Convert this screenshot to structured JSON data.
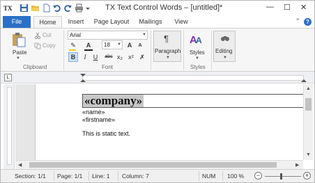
{
  "app": {
    "title": "TX Text Control Words – [untitled]*"
  },
  "window": {
    "minimize": "—",
    "maximize": "☐",
    "close": "✕"
  },
  "quick_access": [
    "app-logo-icon",
    "save-icon",
    "open-folder-icon",
    "new-document-icon",
    "undo-icon",
    "redo-icon",
    "print-icon",
    "qat-dropdown-icon"
  ],
  "tabs": [
    {
      "label": "File"
    },
    {
      "label": "Home"
    },
    {
      "label": "Insert"
    },
    {
      "label": "Page Layout"
    },
    {
      "label": "Mailings"
    },
    {
      "label": "View"
    }
  ],
  "help_label": "?",
  "ribbon": {
    "clipboard": {
      "label": "Clipboard",
      "paste": "Paste",
      "cut": "Cut",
      "copy": "Copy"
    },
    "font": {
      "label": "Font",
      "family": "Arial",
      "size": "18",
      "bold": "B",
      "italic": "I",
      "underline": "U",
      "strikethrough": "abc",
      "subscript": "x₂",
      "superscript": "x²",
      "grow": "A",
      "shrink": "A",
      "font_color": "A",
      "highlight_color": "#f2d027",
      "font_color_value": "#1f1f1f"
    },
    "paragraph": {
      "label": "Paragraph"
    },
    "styles": {
      "label": "Styles",
      "button": "Styles"
    },
    "editing": {
      "label": "Editing"
    }
  },
  "document": {
    "company_field": "«company»",
    "name_field": "«name»",
    "firstname_field": "«firstname»",
    "static_text": "This is static text."
  },
  "status_bar": {
    "section": "Section: 1/1",
    "page": "Page: 1/1",
    "line": "Line: 1",
    "column": "Column: 7",
    "num": "NUM",
    "zoom": "100 %",
    "zoom_level": 1.0
  },
  "colors": {
    "file_tab": "#2b6fc7",
    "accent": "#2b6fc7",
    "selection": "#c8c8c8"
  }
}
